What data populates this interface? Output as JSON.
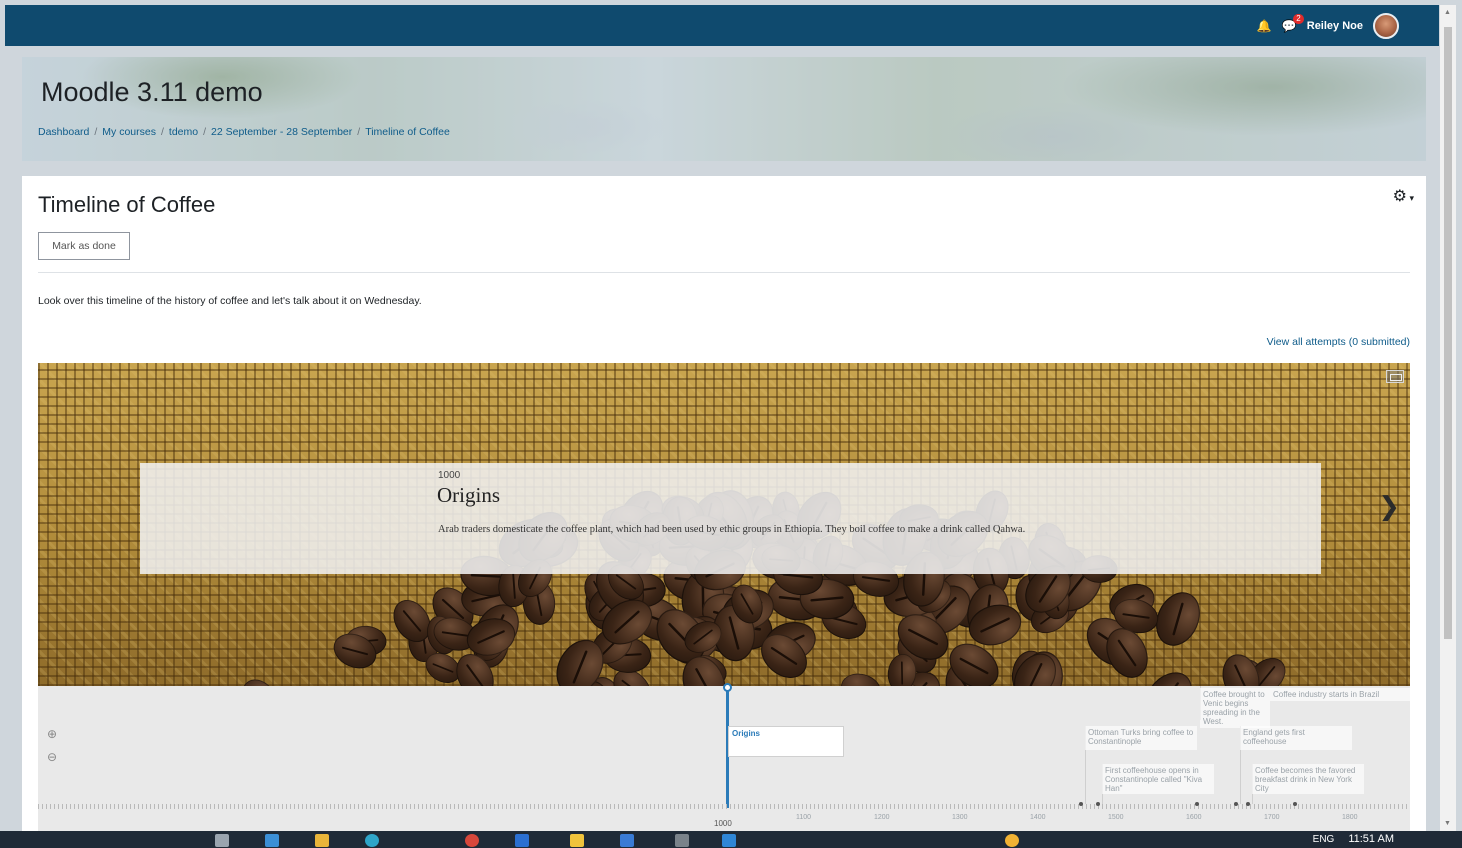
{
  "navbar": {
    "user_name": "Reiley Noe",
    "notification_count": "2",
    "icons": [
      "bell-icon",
      "chat-icon",
      "avatar"
    ]
  },
  "header": {
    "site_title": "Moodle 3.11 demo",
    "breadcrumb": [
      "Dashboard",
      "My courses",
      "tdemo",
      "22 September - 28 September",
      "Timeline of Coffee"
    ]
  },
  "main": {
    "title": "Timeline of Coffee",
    "mark_done_label": "Mark as done",
    "intro": "Look over this timeline of the history of coffee and let's talk about it on Wednesday.",
    "attempts_link": "View all attempts (0 submitted)",
    "gear_icon": "gear-icon"
  },
  "timeline": {
    "slide": {
      "date": "1000",
      "title": "Origins",
      "text": "Arab traders domesticate the coffee plant, which had been used by ethic groups in Ethiopia. They boil coffee to make a drink called Qahwa."
    },
    "flags": {
      "origins": "Origins",
      "coffee_venice": "Coffee brought to Venic begins spreading in the West.",
      "industry_brazil": "Coffee industry starts in Brazil",
      "ottoman": "Ottoman Turks bring coffee to Constantinople",
      "england": "England gets first coffeehouse",
      "first_coffeehouse": "First coffeehouse opens in Constantinople called \"Kiva Han\"",
      "breakfast": "Coffee becomes the favored breakfast drink in New York City"
    },
    "ticks": [
      "1000",
      "1100",
      "1200",
      "1300",
      "1400",
      "1500",
      "1600",
      "1700",
      "1800"
    ]
  },
  "taskbar": {
    "language": "ENG",
    "time": "11:51 AM"
  },
  "colors": {
    "navbar": "#0f4a6e",
    "link": "#0f5c8a",
    "timeline_accent": "#2b7bb9"
  }
}
